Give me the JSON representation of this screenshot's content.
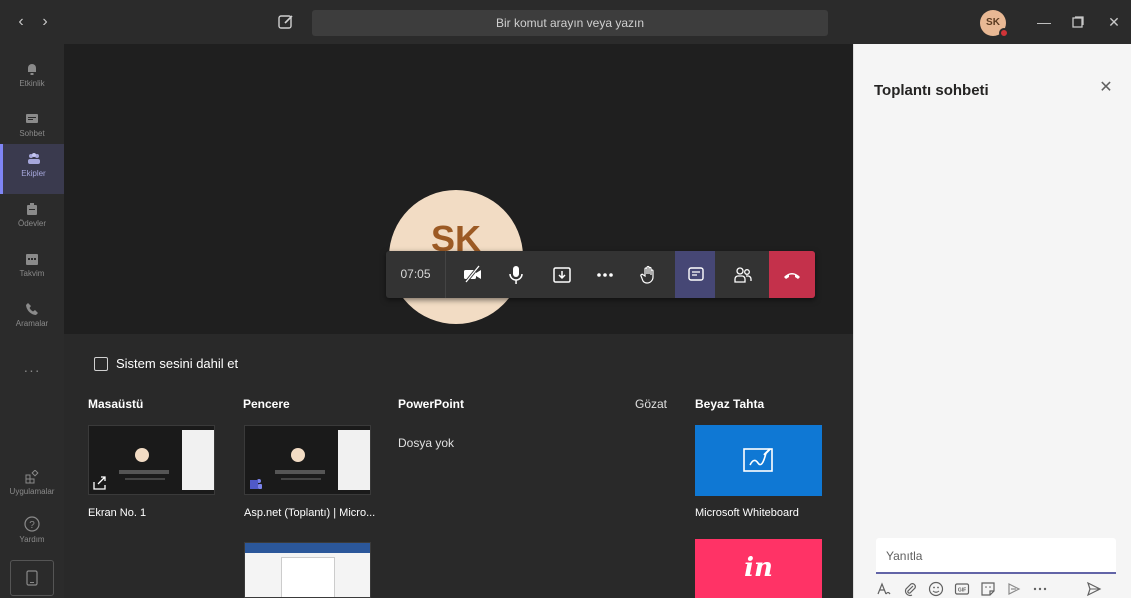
{
  "titlebar": {
    "back_icon": "chevron-left-icon",
    "forward_icon": "chevron-right-icon",
    "search_placeholder": "Bir komut arayın veya yazın",
    "user_initials": "SK",
    "status_color": "#d13438"
  },
  "rail": {
    "items": [
      {
        "label": "Etkinlik",
        "icon": "bell-icon"
      },
      {
        "label": "Sohbet",
        "icon": "chat-icon"
      },
      {
        "label": "Ekipler",
        "icon": "teams-icon",
        "active": true
      },
      {
        "label": "Ödevler",
        "icon": "assignments-icon"
      },
      {
        "label": "Takvim",
        "icon": "calendar-icon"
      },
      {
        "label": "Aramalar",
        "icon": "phone-icon"
      }
    ],
    "more": "···",
    "apps_label": "Uygulamalar",
    "help_label": "Yardım"
  },
  "stage": {
    "participant_initials": "SK"
  },
  "controls": {
    "timer": "07:05",
    "accent_active": "#464775",
    "hangup_color": "#c4314b"
  },
  "share": {
    "system_audio_label": "Sistem sesini dahil et",
    "system_audio_checked": false,
    "columns": {
      "desktop": "Masaüstü",
      "window": "Pencere",
      "powerpoint": "PowerPoint",
      "browse": "Gözat",
      "whiteboard": "Beyaz Tahta"
    },
    "desktop_item": "Ekran No. 1",
    "window_item": "Asp.net (Toplantı) | Micro...",
    "powerpoint_empty": "Dosya yok",
    "whiteboard_item": "Microsoft Whiteboard",
    "invision_logo": "in"
  },
  "chat": {
    "title": "Toplantı sohbeti",
    "reply_placeholder": "Yanıtla"
  }
}
